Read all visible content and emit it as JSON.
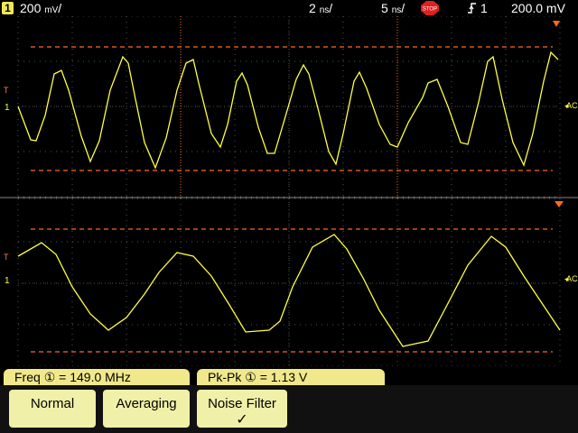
{
  "header": {
    "channel_badge": "1",
    "channel_scale": "200",
    "channel_scale_unit": "mV",
    "timebase_main": "2",
    "timebase_main_unit": "ns",
    "timebase_delay": "5",
    "timebase_delay_unit": "ns",
    "run_state": "STOP",
    "trigger_source": "1",
    "trigger_level": "200.0 mV"
  },
  "markers": {
    "trigger": "T",
    "channel": "1",
    "coupling": "AC"
  },
  "measurements": [
    {
      "label": "Freq",
      "value": "149.0 MHz"
    },
    {
      "label": "Pk-Pk",
      "value": "1.13  V"
    }
  ],
  "softkeys": [
    {
      "label": "Normal",
      "selected": false
    },
    {
      "label": "Averaging",
      "selected": false
    },
    {
      "label": "Noise Filter",
      "selected": true,
      "check": "✓"
    }
  ],
  "colors": {
    "trace": "#ffff40",
    "cursor": "#ff6a1a",
    "grid": "#555555",
    "softkey": "#f0f0a8",
    "badge": "#f0e85a"
  }
}
